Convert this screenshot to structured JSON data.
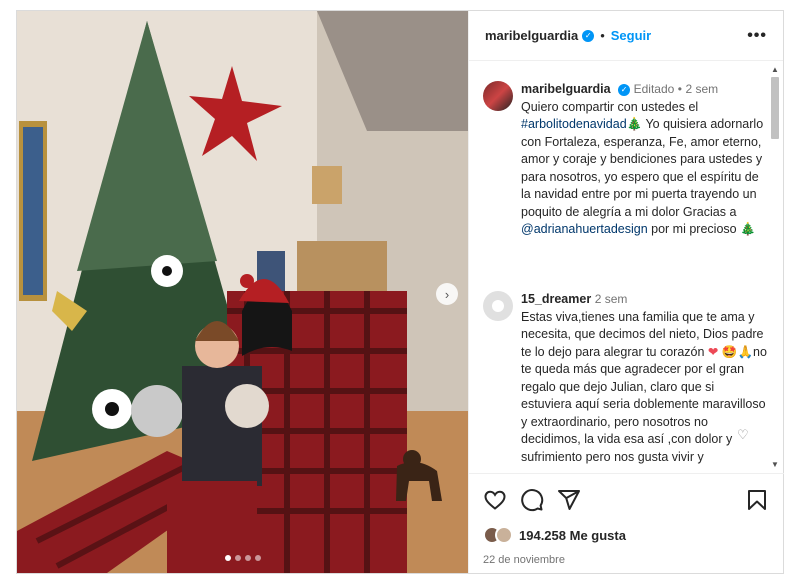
{
  "post": {
    "username": "maribelguardia",
    "follow_label": "Seguir",
    "more_label": "•••",
    "separator": "•"
  },
  "caption": {
    "username": "maribelguardia",
    "edited": "Editado",
    "time": "2 sem",
    "text_1": "Quiero compartir con ustedes el ",
    "hashtag": "#arbolitodenavidad",
    "text_2": " Yo quisiera adornarlo con Fortaleza, esperanza, Fe, amor eterno, amor y coraje y bendiciones para ustedes y para nosotros, yo espero que el espíritu de la navidad entre por mi puerta trayendo un poquito de alegría a mi dolor Gracias a ",
    "mention": "@adrianahuertadesign",
    "text_3": " por mi precioso ",
    "tree_emoji": "🎄"
  },
  "comment": {
    "username": "15_dreamer",
    "time": "2 sem",
    "text_1": "Estas viva,tienes una familia que te ama y necesita, que decimos del nieto, Dios padre te lo dejo para alegrar tu corazón ",
    "heart": "❤",
    "emojis": " 🤩🙏",
    "text_2": "no te queda más que agradecer por el gran regalo que dejo Julian, claro que si estuviera aquí seria doblemente maravilloso y extraordinario, pero nosotros no decidimos, la vida esa así ,con dolor y sufrimiento pero nos gusta vivir y"
  },
  "likes": {
    "count": "194.258",
    "label": "Me gusta"
  },
  "date": "22 de noviembre",
  "icons": [
    "heart-icon",
    "comment-icon",
    "share-icon",
    "bookmark-icon",
    "verified-icon",
    "more-icon",
    "chevron-right-icon"
  ],
  "carousel": {
    "current": 1,
    "total": 4
  },
  "colors": {
    "accent": "#0095f6",
    "text": "#262626",
    "muted": "#737373",
    "link": "#00376b"
  }
}
